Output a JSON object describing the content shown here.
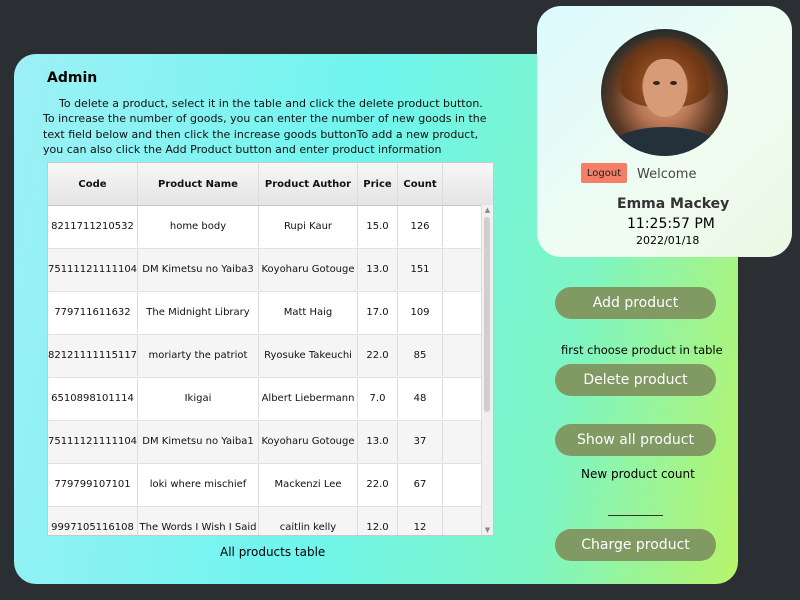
{
  "admin": {
    "title": "Admin",
    "instructions": "To delete a product, select it in the table and click the delete product button. To increase the number of goods, you can enter the number of new goods in the text field below and then click the increase goods buttonTo add a new product, you can also click the Add Product button and enter product information"
  },
  "table": {
    "columns": [
      "Code",
      "Product Name",
      "Product Author",
      "Price",
      "Count"
    ],
    "rows": [
      [
        "8211711210532",
        "home body",
        "Rupi Kaur",
        "15.0",
        "126"
      ],
      [
        "75111121111104",
        "DM Kimetsu no Yaiba3",
        "Koyoharu Gotouge",
        "13.0",
        "151"
      ],
      [
        "779711611632",
        "The Midnight Library",
        "Matt Haig",
        "17.0",
        "109"
      ],
      [
        "82121111115117",
        "moriarty the patriot",
        "Ryosuke Takeuchi",
        "22.0",
        "85"
      ],
      [
        "6510898101114",
        "Ikigai",
        "Albert Liebermann",
        "7.0",
        "48"
      ],
      [
        "75111121111104",
        "DM Kimetsu no Yaiba1",
        "Koyoharu Gotouge",
        "13.0",
        "37"
      ],
      [
        "779799107101",
        "loki where mischief",
        "Mackenzi Lee",
        "22.0",
        "67"
      ],
      [
        "9997105116108",
        "The Words I Wish I Said",
        "caitlin kelly",
        "12.0",
        "12"
      ]
    ],
    "caption": "All products table"
  },
  "actions": {
    "add_label": "Add product",
    "delete_hint": "first choose product in table",
    "delete_label": "Delete product",
    "show_all_label": "Show all product",
    "count_label": "New product count",
    "charge_label": "Charge product"
  },
  "user": {
    "logout_label": "Logout",
    "welcome": "Welcome",
    "name": "Emma Mackey",
    "time": "11:25:57 PM",
    "date": "2022/01/18"
  },
  "colors": {
    "button": "#819a64",
    "logout": "#f47e67",
    "background": "#2b2e33"
  }
}
